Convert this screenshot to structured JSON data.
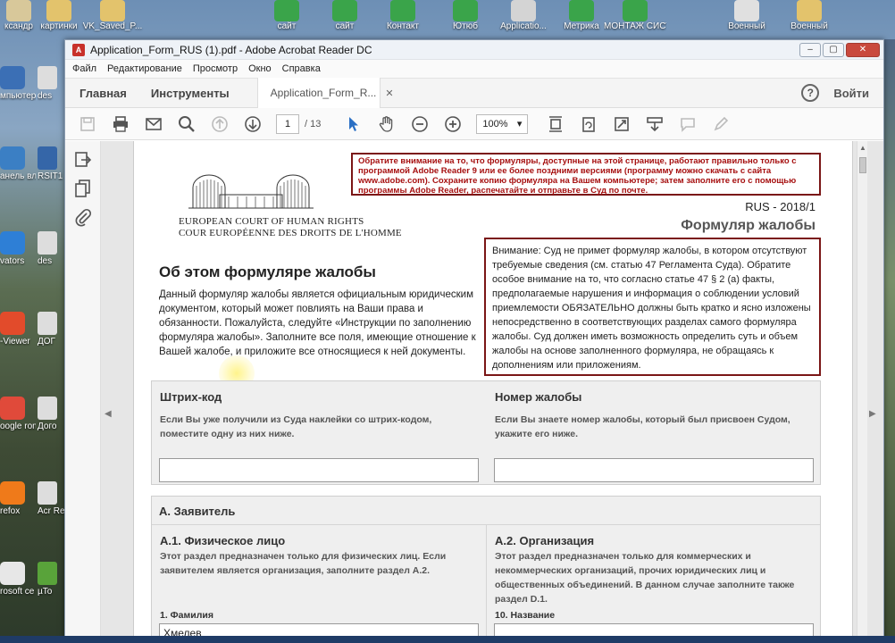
{
  "desktop": {
    "top_icons": [
      {
        "label": "ксандр",
        "color": "#d8c89a"
      },
      {
        "label": "картинки",
        "color": "#e3c36c"
      },
      {
        "label": "VK_Saved_P...",
        "color": "#e3c36c"
      },
      {
        "label": "сайт",
        "color": "#3aa44a"
      },
      {
        "label": "сайт",
        "color": "#3aa44a"
      },
      {
        "label": "Контакт",
        "color": "#3aa44a"
      },
      {
        "label": "Ютюб",
        "color": "#3aa44a"
      },
      {
        "label": "Applicatio...",
        "color": "#d4d4d4"
      },
      {
        "label": "Метрика",
        "color": "#3aa44a"
      },
      {
        "label": "МОНТАЖ СИСТЕМ",
        "color": "#3aa44a"
      },
      {
        "label": "Военный",
        "color": "#e0e0e0"
      },
      {
        "label": "Военный",
        "color": "#e3c36c"
      }
    ],
    "left_icons": [
      {
        "label": "мпьютер",
        "color": "#3b6fb5"
      },
      {
        "label": "анель вления",
        "color": "#3b7fc4"
      },
      {
        "label": "vators",
        "color": "#2e7fd6"
      },
      {
        "label": "-Viewer",
        "color": "#e24b2b"
      },
      {
        "label": "oogle rome",
        "color": "#e04a3a"
      },
      {
        "label": "refox",
        "color": "#ef7a1a"
      },
      {
        "label": "rosoft ce W",
        "color": "#e7e7e7"
      }
    ],
    "left_icons2": [
      {
        "label": "des",
        "color": "#ddd"
      },
      {
        "label": "RSIT1",
        "color": "#3566a8"
      },
      {
        "label": "des",
        "color": "#ddd"
      },
      {
        "label": "ДОГ",
        "color": "#ddd"
      },
      {
        "label": "Дого",
        "color": "#ddd"
      },
      {
        "label": "Acr Read",
        "color": "#ddd"
      },
      {
        "label": "µTo",
        "color": "#59a33a"
      }
    ]
  },
  "window": {
    "title": "Application_Form_RUS (1).pdf - Adobe Acrobat Reader DC",
    "app_icon": "A",
    "controls": {
      "minimize": "‒",
      "maximize": "▢",
      "close": "✕"
    }
  },
  "menu": [
    "Файл",
    "Редактирование",
    "Просмотр",
    "Окно",
    "Справка"
  ],
  "tabs": {
    "home": "Главная",
    "tools": "Инструменты",
    "document": "Application_Form_R...",
    "close": "✕",
    "help": "?",
    "login": "Войти"
  },
  "toolbar": {
    "page_current": "1",
    "page_total": "/ 13",
    "zoom": "100%",
    "zoom_arrow": "▾"
  },
  "page": {
    "court_en": "EUROPEAN COURT OF HUMAN RIGHTS",
    "court_fr": "COUR EUROPÉENNE DES DROITS DE L'HOMME",
    "warning": "Обратите внимание на то, что формуляры, доступные на этой странице, работают правильно только с программой Adobe Reader 9 или ее более поздними версиями (программу можно скачать с сайта www.adobe.com). Сохраните копию формуляра на Вашем компьютере; затем заполните его с помощью программы Adobe Reader, распечатайте и отправьте в Суд по почте.",
    "form_id": "RUS - 2018/1",
    "form_title": "Формуляр жалобы",
    "about_heading": "Об этом формуляре жалобы",
    "about_text": "Данный формуляр жалобы является официальным юридическим документом, который может повлиять на Ваши права и обязанности. Пожалуйста, следуйте «Инструкции по заполнению формуляра жалобы». Заполните все поля, имеющие отношение к Вашей жалобе, и приложите все относящиеся к ней документы.",
    "notice": "Внимание: Суд не примет формуляр жалобы, в котором отсутствуют требуемые сведения (см. статью 47 Регламента Суда). Обратите особое внимание на то, что согласно статье 47 § 2 (а) факты, предполагаемые нарушения и информация о соблюдении условий приемлемости ОБЯЗАТЕЛЬНО должны быть кратко и ясно изложены непосредственно в соответствующих разделах самого формуляра жалобы. Суд должен иметь возможность определить суть и объем жалобы на основе заполненного формуляра, не обращаясь к дополнениям или приложениям.",
    "barcode_title": "Штрих-код",
    "barcode_text": "Если Вы уже получили из Суда наклейки со штрих-кодом, поместите одну из них ниже.",
    "number_title": "Номер жалобы",
    "number_text": "Если Вы знаете номер жалобы, который был присвоен Судом, укажите его ниже.",
    "section_a": "А. Заявитель",
    "a1_title": "А.1. Физическое лицо",
    "a1_text": "Этот раздел предназначен только для физических лиц. Если заявителем является организация, заполните раздел А.2.",
    "a1_field_label": "1. Фамилия",
    "a1_field_value": "Хмелев",
    "a2_title": "А.2. Организация",
    "a2_text": "Этот раздел предназначен только для коммерческих и некоммерческих организаций, прочих юридических лиц и общественных объединений. В данном случае заполните также раздел D.1.",
    "a2_field_label": "10. Название",
    "a2_field_value": ""
  }
}
